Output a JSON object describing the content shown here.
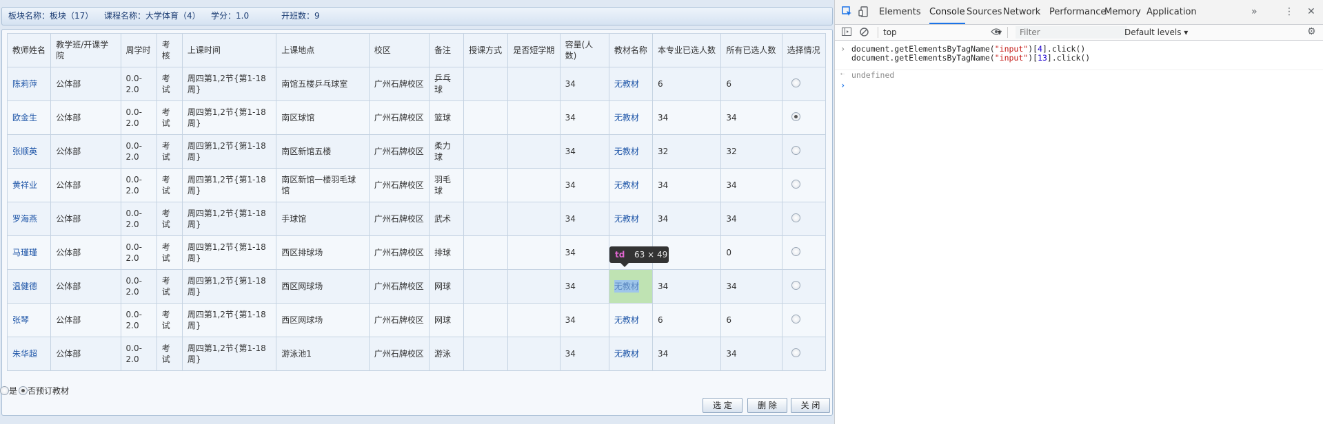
{
  "info_bar": {
    "block_name": "板块名称：板块（17）",
    "course_name": "课程名称：大学体育（4）",
    "credit": "学分：1.0",
    "class_count": "开班数：9"
  },
  "table": {
    "headers": [
      "教师姓名",
      "教学班/开课学院",
      "周学时",
      "考核",
      "上课时间",
      "上课地点",
      "校区",
      "备注",
      "授课方式",
      "是否短学期",
      "容量(人数)",
      "教材名称",
      "本专业已选人数",
      "所有已选人数",
      "选择情况"
    ],
    "rows": [
      {
        "teacher": "陈莉萍",
        "college": "公体部",
        "hours": "0.0-2.0",
        "exam": "考试",
        "time": "周四第1,2节{第1-18周}",
        "place": "南馆五楼乒乓球室",
        "campus": "广州石牌校区",
        "note": "乒乓球",
        "mode": "",
        "short": "",
        "capacity": "34",
        "textbook": "无教材",
        "major_count": "6",
        "all_count": "6",
        "selected": false
      },
      {
        "teacher": "欧金生",
        "college": "公体部",
        "hours": "0.0-2.0",
        "exam": "考试",
        "time": "周四第1,2节{第1-18周}",
        "place": "南区球馆",
        "campus": "广州石牌校区",
        "note": "篮球",
        "mode": "",
        "short": "",
        "capacity": "34",
        "textbook": "无教材",
        "major_count": "34",
        "all_count": "34",
        "selected": true
      },
      {
        "teacher": "张顺英",
        "college": "公体部",
        "hours": "0.0-2.0",
        "exam": "考试",
        "time": "周四第1,2节{第1-18周}",
        "place": "南区新馆五楼",
        "campus": "广州石牌校区",
        "note": "柔力球",
        "mode": "",
        "short": "",
        "capacity": "34",
        "textbook": "无教材",
        "major_count": "32",
        "all_count": "32",
        "selected": false
      },
      {
        "teacher": "黄祥业",
        "college": "公体部",
        "hours": "0.0-2.0",
        "exam": "考试",
        "time": "周四第1,2节{第1-18周}",
        "place": "南区新馆一楼羽毛球馆",
        "campus": "广州石牌校区",
        "note": "羽毛球",
        "mode": "",
        "short": "",
        "capacity": "34",
        "textbook": "无教材",
        "major_count": "34",
        "all_count": "34",
        "selected": false
      },
      {
        "teacher": "罗海燕",
        "college": "公体部",
        "hours": "0.0-2.0",
        "exam": "考试",
        "time": "周四第1,2节{第1-18周}",
        "place": "手球馆",
        "campus": "广州石牌校区",
        "note": "武术",
        "mode": "",
        "short": "",
        "capacity": "34",
        "textbook": "无教材",
        "major_count": "34",
        "all_count": "34",
        "selected": false
      },
      {
        "teacher": "马瑾瑾",
        "college": "公体部",
        "hours": "0.0-2.0",
        "exam": "考试",
        "time": "周四第1,2节{第1-18周}",
        "place": "西区排球场",
        "campus": "广州石牌校区",
        "note": "排球",
        "mode": "",
        "short": "",
        "capacity": "34",
        "textbook": "",
        "major_count": "",
        "all_count": "0",
        "selected": false
      },
      {
        "teacher": "温健德",
        "college": "公体部",
        "hours": "0.0-2.0",
        "exam": "考试",
        "time": "周四第1,2节{第1-18周}",
        "place": "西区网球场",
        "campus": "广州石牌校区",
        "note": "网球",
        "mode": "",
        "short": "",
        "capacity": "34",
        "textbook": "无教材",
        "major_count": "34",
        "all_count": "34",
        "selected": false
      },
      {
        "teacher": "张琴",
        "college": "公体部",
        "hours": "0.0-2.0",
        "exam": "考试",
        "time": "周四第1,2节{第1-18周}",
        "place": "西区网球场",
        "campus": "广州石牌校区",
        "note": "网球",
        "mode": "",
        "short": "",
        "capacity": "34",
        "textbook": "无教材",
        "major_count": "6",
        "all_count": "6",
        "selected": false
      },
      {
        "teacher": "朱华超",
        "college": "公体部",
        "hours": "0.0-2.0",
        "exam": "考试",
        "time": "周四第1,2节{第1-18周}",
        "place": "游泳池1",
        "campus": "广州石牌校区",
        "note": "游泳",
        "mode": "",
        "short": "",
        "capacity": "34",
        "textbook": "无教材",
        "major_count": "34",
        "all_count": "34",
        "selected": false
      }
    ]
  },
  "tooltip": {
    "tag": "td",
    "dims": "63 × 49"
  },
  "textbook_option": {
    "yes": "是",
    "no": "否预订教材"
  },
  "buttons": {
    "select": "选 定",
    "delete": "删 除",
    "close": "关 闭"
  },
  "devtools": {
    "tabs": [
      "Elements",
      "Console",
      "Sources",
      "Network",
      "Performance",
      "Memory",
      "Application"
    ],
    "active_tab": "Console",
    "more": "»",
    "context": "top",
    "filter_placeholder": "Filter",
    "levels": "Default levels ▾",
    "console_lines": [
      {
        "prefix": "document.getElementsByTagName(",
        "arg": "\"input\"",
        "mid": ")[",
        "idx": "4",
        "suffix": "].click()"
      },
      {
        "prefix": "document.getElementsByTagName(",
        "arg": "\"input\"",
        "mid": ")[",
        "idx": "13",
        "suffix": "].click()"
      }
    ],
    "result": "undefined",
    "colors": {
      "active_tab": "#1a73e8",
      "string": "#c41a16",
      "number": "#1c00cf"
    }
  }
}
